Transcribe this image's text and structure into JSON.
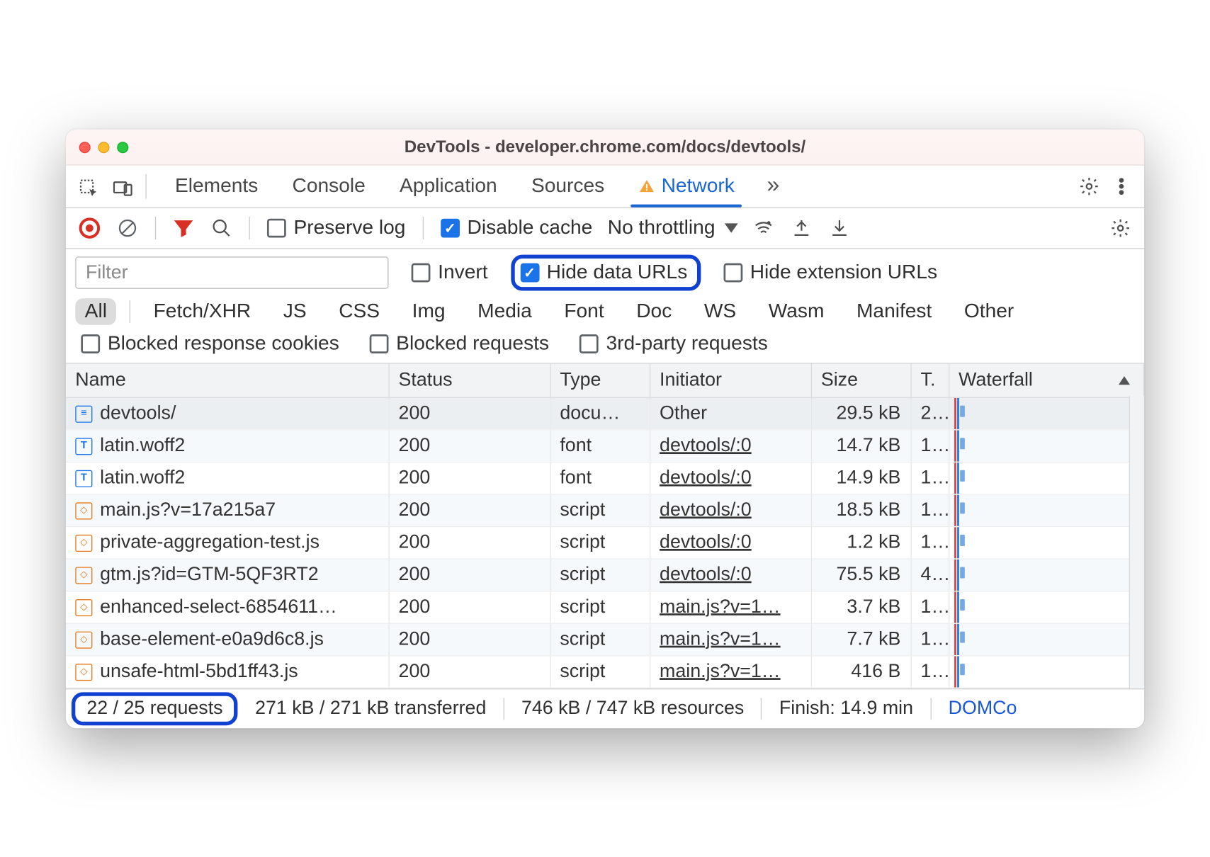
{
  "window": {
    "title": "DevTools - developer.chrome.com/docs/devtools/"
  },
  "tabs": {
    "items": [
      "Elements",
      "Console",
      "Application",
      "Sources",
      "Network"
    ],
    "active_index": 4,
    "has_warning_on_active": true,
    "more": "»"
  },
  "toolbar": {
    "preserve_log": {
      "checked": false,
      "label": "Preserve log"
    },
    "disable_cache": {
      "checked": true,
      "label": "Disable cache"
    },
    "throttling": {
      "label": "No throttling"
    }
  },
  "filter": {
    "placeholder": "Filter",
    "invert": {
      "checked": false,
      "label": "Invert"
    },
    "hide_data_urls": {
      "checked": true,
      "label": "Hide data URLs"
    },
    "hide_extension_urls": {
      "checked": false,
      "label": "Hide extension URLs"
    }
  },
  "type_chips": {
    "items": [
      "All",
      "Fetch/XHR",
      "JS",
      "CSS",
      "Img",
      "Media",
      "Font",
      "Doc",
      "WS",
      "Wasm",
      "Manifest",
      "Other"
    ],
    "active_index": 0
  },
  "extra_filters": {
    "blocked_response_cookies": {
      "checked": false,
      "label": "Blocked response cookies"
    },
    "blocked_requests": {
      "checked": false,
      "label": "Blocked requests"
    },
    "third_party": {
      "checked": false,
      "label": "3rd-party requests"
    }
  },
  "table": {
    "columns": [
      "Name",
      "Status",
      "Type",
      "Initiator",
      "Size",
      "T.",
      "Waterfall"
    ],
    "rows": [
      {
        "icon": "doc",
        "name": "devtools/",
        "status": "200",
        "type": "docu…",
        "initiator": "Other",
        "initiator_link": false,
        "size": "29.5 kB",
        "time": "2..",
        "selected": true
      },
      {
        "icon": "font",
        "name": "latin.woff2",
        "status": "200",
        "type": "font",
        "initiator": "devtools/:0",
        "initiator_link": true,
        "size": "14.7 kB",
        "time": "1.."
      },
      {
        "icon": "font",
        "name": "latin.woff2",
        "status": "200",
        "type": "font",
        "initiator": "devtools/:0",
        "initiator_link": true,
        "size": "14.9 kB",
        "time": "1.."
      },
      {
        "icon": "js",
        "name": "main.js?v=17a215a7",
        "status": "200",
        "type": "script",
        "initiator": "devtools/:0",
        "initiator_link": true,
        "size": "18.5 kB",
        "time": "1.."
      },
      {
        "icon": "js",
        "name": "private-aggregation-test.js",
        "status": "200",
        "type": "script",
        "initiator": "devtools/:0",
        "initiator_link": true,
        "size": "1.2 kB",
        "time": "1.."
      },
      {
        "icon": "js",
        "name": "gtm.js?id=GTM-5QF3RT2",
        "status": "200",
        "type": "script",
        "initiator": "devtools/:0",
        "initiator_link": true,
        "size": "75.5 kB",
        "time": "4.."
      },
      {
        "icon": "js",
        "name": "enhanced-select-6854611…",
        "status": "200",
        "type": "script",
        "initiator": "main.js?v=1…",
        "initiator_link": true,
        "size": "3.7 kB",
        "time": "1.."
      },
      {
        "icon": "js",
        "name": "base-element-e0a9d6c8.js",
        "status": "200",
        "type": "script",
        "initiator": "main.js?v=1…",
        "initiator_link": true,
        "size": "7.7 kB",
        "time": "1.."
      },
      {
        "icon": "js",
        "name": "unsafe-html-5bd1ff43.js",
        "status": "200",
        "type": "script",
        "initiator": "main.js?v=1…",
        "initiator_link": true,
        "size": "416 B",
        "time": "1.."
      }
    ]
  },
  "footer": {
    "requests": "22 / 25 requests",
    "transferred": "271 kB / 271 kB transferred",
    "resources": "746 kB / 747 kB resources",
    "finish": "Finish: 14.9 min",
    "domcontent": "DOMCo"
  }
}
